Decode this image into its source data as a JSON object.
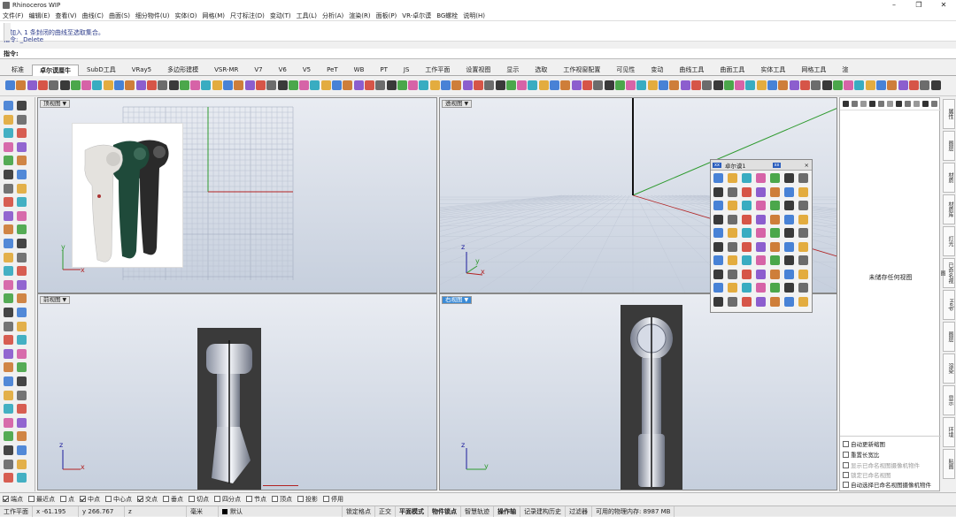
{
  "app": {
    "title": "Rhinoceros WIP"
  },
  "menu": [
    "文件(F)",
    "编辑(E)",
    "查看(V)",
    "曲线(C)",
    "曲面(S)",
    "细分物件(U)",
    "实体(O)",
    "网格(M)",
    "尺寸标注(D)",
    "变动(T)",
    "工具(L)",
    "分析(A)",
    "渲染(R)",
    "面板(P)",
    "VR-卓尔谟",
    "BG螺栓",
    "说明(H)"
  ],
  "command": {
    "history": [
      "已加入 1 条封闭的曲线至选取集合。",
      "指令: _Delete"
    ],
    "prompt": "指令:"
  },
  "tabs": [
    "标准",
    "卓尔谟厘牛",
    "SubD工具",
    "VRay5",
    "多边形建模",
    "VSR-MR",
    "V7",
    "V6",
    "V5",
    "PeT",
    "WB",
    "PT",
    "JS",
    "工作平面",
    "设置视图",
    "显示",
    "选取",
    "工作视窗配置",
    "可见性",
    "变动",
    "曲线工具",
    "曲面工具",
    "实体工具",
    "网格工具",
    "渲"
  ],
  "active_tab": "卓尔谟厘牛",
  "viewports": {
    "top": {
      "label": "顶视图"
    },
    "perspective": {
      "label": "透视图"
    },
    "front": {
      "label": "前视图"
    },
    "right": {
      "label": "右视图"
    }
  },
  "axis": {
    "x": "x",
    "y": "y",
    "z": "z"
  },
  "palette": {
    "title": "卓尔谟1",
    "close": "×"
  },
  "panel": {
    "empty_text": "未储存任何视图",
    "options": [
      {
        "label": "自动更新缩图",
        "checked": false,
        "enabled": true
      },
      {
        "label": "重置长宽比",
        "checked": false,
        "enabled": true
      },
      {
        "label": "显示已命名视图摄像机物件",
        "checked": false,
        "enabled": false
      },
      {
        "label": "锁定已命名视图",
        "checked": false,
        "enabled": false
      },
      {
        "label": "自动选择已命名视图摄像机物件",
        "checked": false,
        "enabled": true
      }
    ]
  },
  "right_tabs": [
    "属性",
    "图层",
    "材质",
    "材质库",
    "灯光",
    "已命名视图",
    "Help",
    "图层",
    "渲染",
    "显示",
    "环境",
    "贴图"
  ],
  "osnaps": [
    {
      "label": "端点",
      "checked": true
    },
    {
      "label": "最近点",
      "checked": false
    },
    {
      "label": "点",
      "checked": false
    },
    {
      "label": "中点",
      "checked": true
    },
    {
      "label": "中心点",
      "checked": false
    },
    {
      "label": "交点",
      "checked": true
    },
    {
      "label": "垂点",
      "checked": false
    },
    {
      "label": "切点",
      "checked": false
    },
    {
      "label": "四分点",
      "checked": false
    },
    {
      "label": "节点",
      "checked": false
    },
    {
      "label": "顶点",
      "checked": false
    },
    {
      "label": "投影",
      "checked": false
    },
    {
      "label": "停用",
      "checked": false
    }
  ],
  "status": {
    "cplane": "工作平面",
    "x": "x -61.195",
    "y": "y 266.767",
    "z": "z",
    "units": "毫米",
    "layer": "默认",
    "toggles": [
      "锁定格点",
      "正交",
      "平面模式",
      "物件锁点",
      "智慧轨迹",
      "操作轴",
      "记录建构历史",
      "过滤器"
    ],
    "bold_toggles": [
      "平面模式",
      "物件锁点",
      "操作轴"
    ],
    "memory": "可用的物理内存: 8987 MB"
  },
  "colors": {
    "axis_x": "#b22222",
    "axis_y": "#2e9a2e",
    "axis_z": "#1c1c9c",
    "active_viewport": "#3a8ad6",
    "product_white": "#e4e2de",
    "product_green": "#1f4a3a",
    "product_black": "#2a2a2a"
  }
}
